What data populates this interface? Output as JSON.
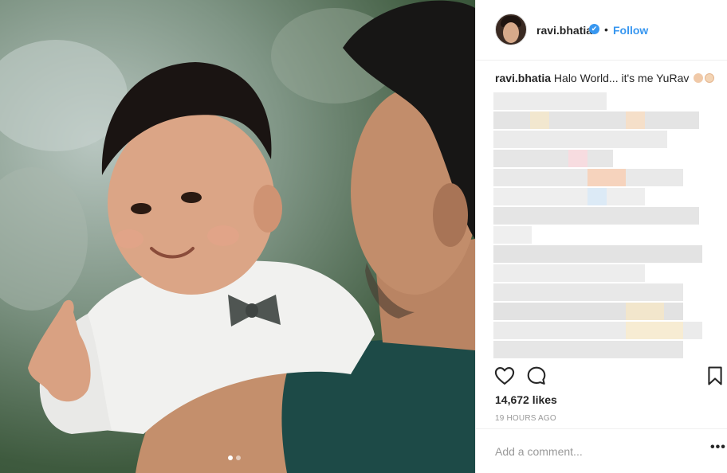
{
  "post": {
    "photo_alt": "",
    "carousel": {
      "count": 2,
      "active": 1
    }
  },
  "header": {
    "username": "ravi.bhatia",
    "verified_icon": "✔",
    "separator": "•",
    "follow_label": "Follow"
  },
  "caption": {
    "username": "ravi.bhatia",
    "text": "Halo World... it's me YuRav"
  },
  "stats": {
    "likes": "14,672 likes",
    "timestamp": "19 HOURS AGO"
  },
  "comment": {
    "placeholder": "Add a comment...",
    "more_label": "•••"
  },
  "icons": {
    "like": "heart-icon",
    "comment": "comment-bubble-icon",
    "save": "bookmark-icon",
    "verified": "verified-badge-icon",
    "more": "more-options-icon"
  },
  "colors": {
    "link": "#3897f0",
    "text": "#262626",
    "muted": "#999999",
    "border": "#efefef"
  }
}
